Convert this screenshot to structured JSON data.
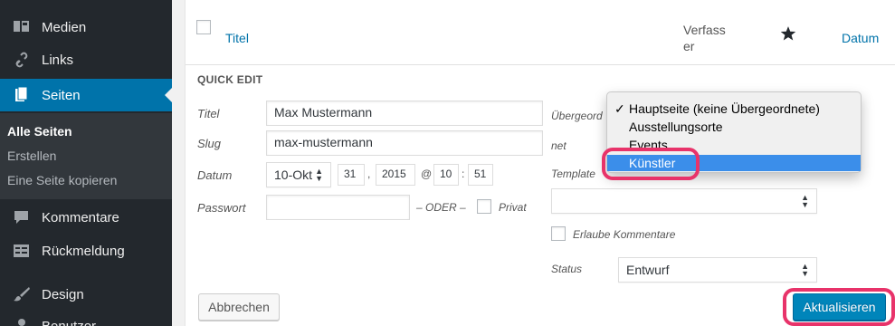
{
  "sidebar": {
    "items": [
      {
        "label": "Medien",
        "icon": "media-icon"
      },
      {
        "label": "Links",
        "icon": "link-icon"
      },
      {
        "label": "Seiten",
        "icon": "pages-icon"
      },
      {
        "label": "Kommentare",
        "icon": "comment-icon"
      },
      {
        "label": "Rückmeldung",
        "icon": "feedback-icon"
      },
      {
        "label": "Design",
        "icon": "brush-icon"
      },
      {
        "label": "Benutzer",
        "icon": "user-icon"
      }
    ],
    "submenu": [
      "Alle Seiten",
      "Erstellen",
      "Eine Seite kopieren"
    ]
  },
  "table": {
    "col_title": "Titel",
    "col_author": "Verfasser",
    "col_date": "Datum"
  },
  "quick_edit": {
    "heading": "QUICK EDIT",
    "title_label": "Titel",
    "title_value": "Max Mustermann",
    "slug_label": "Slug",
    "slug_value": "max-mustermann",
    "date_label": "Datum",
    "date_month": "10-Okt",
    "date_day": "31",
    "date_sep1": ",",
    "date_year": "2015",
    "date_at": "@",
    "date_hour": "10",
    "date_sep2": ":",
    "date_min": "51",
    "password_label": "Passwort",
    "oder": "– ODER –",
    "private_label": "Privat",
    "parent_label": "Übergeordnet",
    "template_label": "Template",
    "allow_comments_label": "Erlaube Kommentare",
    "status_label": "Status",
    "status_value": "Entwurf",
    "cancel_label": "Abbrechen",
    "update_label": "Aktualisieren"
  },
  "parent_dropdown": {
    "options": [
      "Hauptseite (keine Übergeordnete)",
      "Ausstellungsorte",
      "Events",
      "Künstler"
    ],
    "checked_index": 0,
    "highlighted_index": 3,
    "check_glyph": "✓"
  },
  "colors": {
    "sidebar_bg": "#23282d",
    "accent": "#0073aa",
    "highlight_ring": "#e8336a",
    "dropdown_highlight": "#3b8eea"
  }
}
